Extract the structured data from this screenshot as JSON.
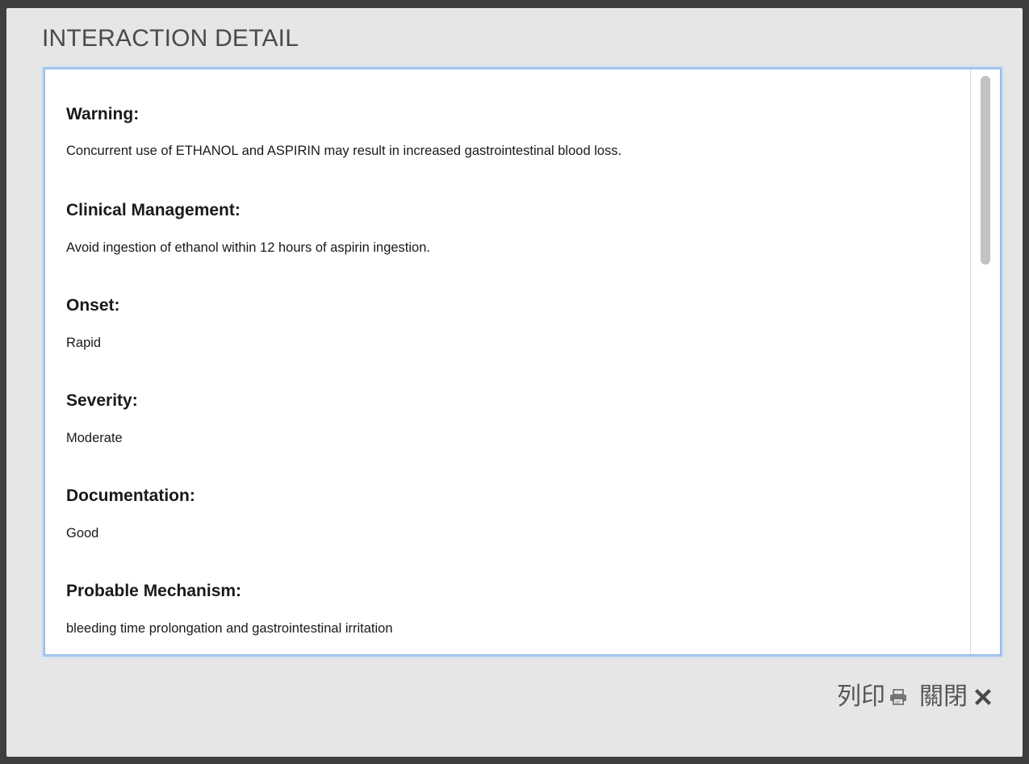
{
  "dialog": {
    "title": "INTERACTION DETAIL"
  },
  "sections": [
    {
      "heading": "Warning:",
      "text": "Concurrent use of ETHANOL and ASPIRIN may result in increased gastrointestinal blood loss."
    },
    {
      "heading": "Clinical Management:",
      "text": "Avoid ingestion of ethanol within 12 hours of aspirin ingestion."
    },
    {
      "heading": "Onset:",
      "text": "Rapid"
    },
    {
      "heading": "Severity:",
      "text": "Moderate"
    },
    {
      "heading": "Documentation:",
      "text": "Good"
    },
    {
      "heading": "Probable Mechanism:",
      "text": "bleeding time prolongation and gastrointestinal irritation"
    }
  ],
  "footer": {
    "print_label": "列印",
    "print_icon": "printer-icon",
    "close_label": "關閉",
    "close_icon": "close-icon"
  },
  "colors": {
    "dialog_bg": "#e6e6e6",
    "frame_border": "#a9c9ef",
    "overlay": "#3f3f3f"
  }
}
